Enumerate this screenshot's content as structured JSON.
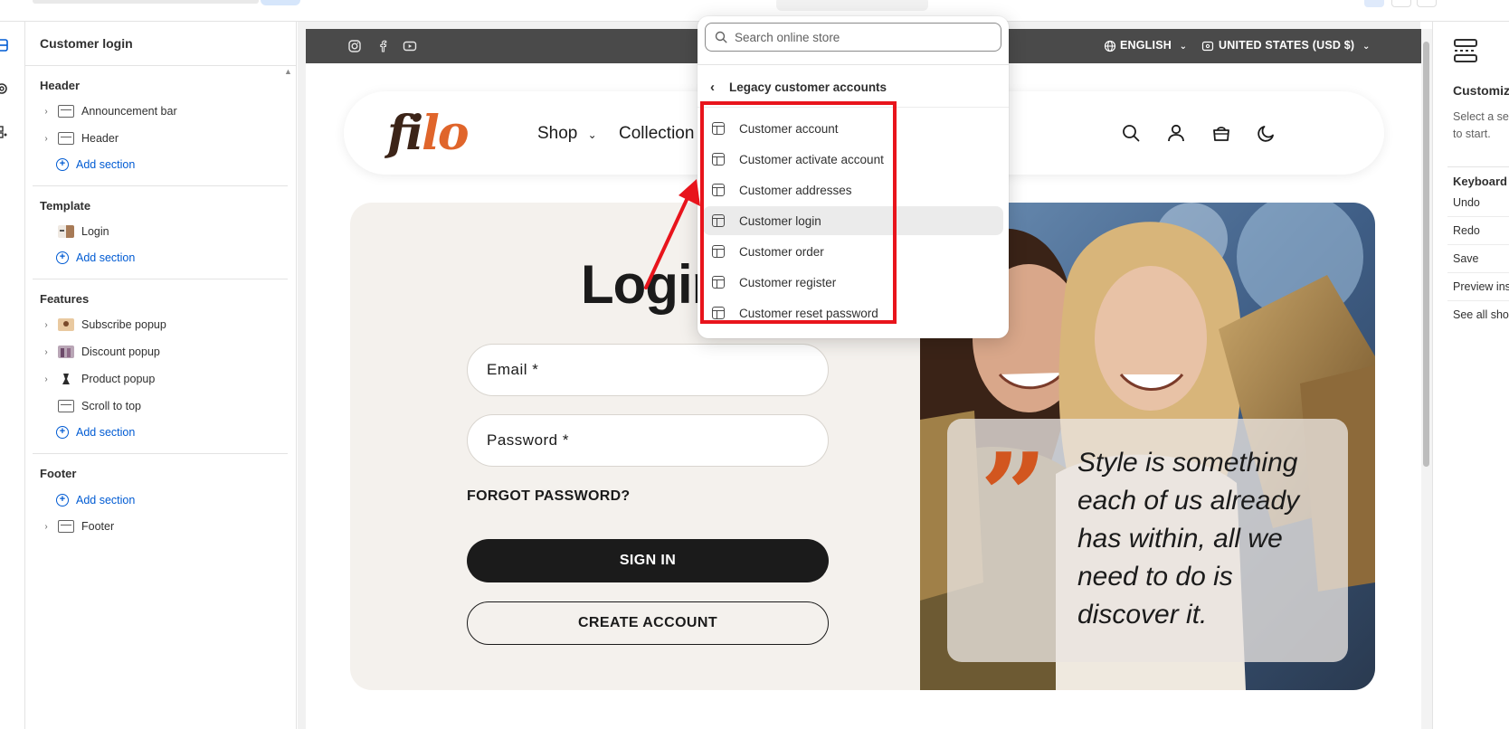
{
  "left_panel": {
    "title": "Customer login",
    "groups": {
      "header": {
        "title": "Header",
        "items": [
          "Announcement bar",
          "Header"
        ],
        "add_label": "Add section"
      },
      "template": {
        "title": "Template",
        "items": [
          "Login"
        ],
        "add_label": "Add section"
      },
      "features": {
        "title": "Features",
        "items": [
          "Subscribe popup",
          "Discount popup",
          "Product popup",
          "Scroll to top"
        ],
        "add_label": "Add section"
      },
      "footer": {
        "title": "Footer",
        "add_label": "Add section",
        "items": [
          "Footer"
        ]
      }
    }
  },
  "announcement": {
    "social_icons": [
      "instagram-icon",
      "facebook-icon",
      "youtube-icon"
    ],
    "language": "ENGLISH",
    "currency": "UNITED STATES (USD $)"
  },
  "store_header": {
    "logo_part1": "fi",
    "logo_part2": "lo",
    "nav": [
      "Shop",
      "Collection"
    ],
    "icons": [
      "search-icon",
      "account-icon",
      "cart-icon",
      "moon-icon"
    ]
  },
  "login": {
    "title": "Login",
    "email_label": "Email *",
    "password_label": "Password *",
    "forgot": "FORGOT PASSWORD?",
    "sign_in": "SIGN IN",
    "create_account": "CREATE ACCOUNT",
    "quote": "Style is something each of us already has within, all we need to do is discover it."
  },
  "dropdown": {
    "search_placeholder": "Search online store",
    "back_label": "Legacy customer accounts",
    "items": [
      "Customer account",
      "Customer activate account",
      "Customer addresses",
      "Customer login",
      "Customer order",
      "Customer register",
      "Customer reset password"
    ],
    "selected": "Customer login"
  },
  "right_panel": {
    "title": "Customize",
    "desc_line1": "Select a se",
    "desc_line2": "to start.",
    "kb_title": "Keyboard",
    "shortcuts": [
      "Undo",
      "Redo",
      "Save",
      "Preview ins",
      "See all sho"
    ]
  },
  "colors": {
    "accent": "#005bd3",
    "brand_orange": "#e0652b",
    "highlight_red": "#e8141c",
    "dark": "#1b1b1b"
  }
}
